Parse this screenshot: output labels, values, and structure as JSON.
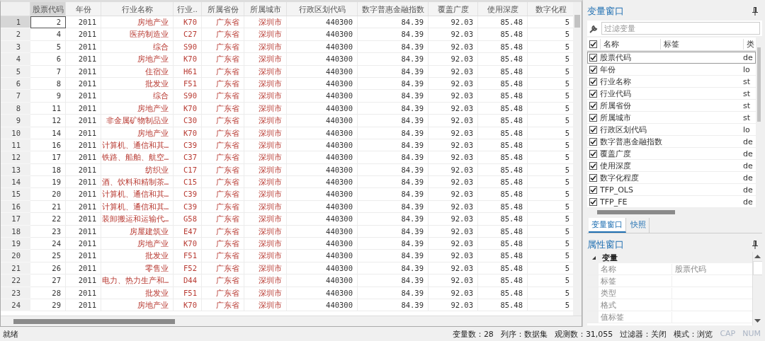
{
  "data_editor": {
    "columns": [
      {
        "label": "股票代码",
        "kind": "numeric",
        "selected": true
      },
      {
        "label": "年份",
        "kind": "numeric",
        "selected": false
      },
      {
        "label": "行业名称",
        "kind": "string",
        "selected": false
      },
      {
        "label": "行业..",
        "kind": "string",
        "selected": false
      },
      {
        "label": "所属省份",
        "kind": "string",
        "selected": false
      },
      {
        "label": "所属城市",
        "kind": "string",
        "selected": false
      },
      {
        "label": "行政区划代码",
        "kind": "numeric",
        "selected": false
      },
      {
        "label": "数字普惠金融指数",
        "kind": "numeric",
        "selected": false
      },
      {
        "label": "覆盖广度",
        "kind": "numeric",
        "selected": false
      },
      {
        "label": "使用深度",
        "kind": "numeric",
        "selected": false
      },
      {
        "label": "数字化程",
        "kind": "numeric",
        "selected": false
      }
    ],
    "rows": [
      {
        "label": "1",
        "selected": true,
        "cells": [
          "2",
          "2011",
          "房地产业",
          "K70",
          "广东省",
          "深圳市",
          "440300",
          "84.39",
          "92.03",
          "85.48",
          "5"
        ]
      },
      {
        "label": "2",
        "selected": false,
        "cells": [
          "4",
          "2011",
          "医药制造业",
          "C27",
          "广东省",
          "深圳市",
          "440300",
          "84.39",
          "92.03",
          "85.48",
          "5"
        ]
      },
      {
        "label": "3",
        "selected": false,
        "cells": [
          "5",
          "2011",
          "综合",
          "S90",
          "广东省",
          "深圳市",
          "440300",
          "84.39",
          "92.03",
          "85.48",
          "5"
        ]
      },
      {
        "label": "4",
        "selected": false,
        "cells": [
          "6",
          "2011",
          "房地产业",
          "K70",
          "广东省",
          "深圳市",
          "440300",
          "84.39",
          "92.03",
          "85.48",
          "5"
        ]
      },
      {
        "label": "5",
        "selected": false,
        "cells": [
          "7",
          "2011",
          "住宿业",
          "H61",
          "广东省",
          "深圳市",
          "440300",
          "84.39",
          "92.03",
          "85.48",
          "5"
        ]
      },
      {
        "label": "6",
        "selected": false,
        "cells": [
          "8",
          "2011",
          "批发业",
          "F51",
          "广东省",
          "深圳市",
          "440300",
          "84.39",
          "92.03",
          "85.48",
          "5"
        ]
      },
      {
        "label": "7",
        "selected": false,
        "cells": [
          "9",
          "2011",
          "综合",
          "S90",
          "广东省",
          "深圳市",
          "440300",
          "84.39",
          "92.03",
          "85.48",
          "5"
        ]
      },
      {
        "label": "8",
        "selected": false,
        "cells": [
          "11",
          "2011",
          "房地产业",
          "K70",
          "广东省",
          "深圳市",
          "440300",
          "84.39",
          "92.03",
          "85.48",
          "5"
        ]
      },
      {
        "label": "9",
        "selected": false,
        "cells": [
          "12",
          "2011",
          "非金属矿物制品业",
          "C30",
          "广东省",
          "深圳市",
          "440300",
          "84.39",
          "92.03",
          "85.48",
          "5"
        ]
      },
      {
        "label": "10",
        "selected": false,
        "cells": [
          "14",
          "2011",
          "房地产业",
          "K70",
          "广东省",
          "深圳市",
          "440300",
          "84.39",
          "92.03",
          "85.48",
          "5"
        ]
      },
      {
        "label": "11",
        "selected": false,
        "cells": [
          "16",
          "2011",
          "计算机、通信和其…",
          "C39",
          "广东省",
          "深圳市",
          "440300",
          "84.39",
          "92.03",
          "85.48",
          "5"
        ]
      },
      {
        "label": "12",
        "selected": false,
        "cells": [
          "17",
          "2011",
          "铁路、船舶、航空…",
          "C37",
          "广东省",
          "深圳市",
          "440300",
          "84.39",
          "92.03",
          "85.48",
          "5"
        ]
      },
      {
        "label": "13",
        "selected": false,
        "cells": [
          "18",
          "2011",
          "纺织业",
          "C17",
          "广东省",
          "深圳市",
          "440300",
          "84.39",
          "92.03",
          "85.48",
          "5"
        ]
      },
      {
        "label": "14",
        "selected": false,
        "cells": [
          "19",
          "2011",
          "酒、饮料和精制茶…",
          "C15",
          "广东省",
          "深圳市",
          "440300",
          "84.39",
          "92.03",
          "85.48",
          "5"
        ]
      },
      {
        "label": "15",
        "selected": false,
        "cells": [
          "20",
          "2011",
          "计算机、通信和其…",
          "C39",
          "广东省",
          "深圳市",
          "440300",
          "84.39",
          "92.03",
          "85.48",
          "5"
        ]
      },
      {
        "label": "16",
        "selected": false,
        "cells": [
          "21",
          "2011",
          "计算机、通信和其…",
          "C39",
          "广东省",
          "深圳市",
          "440300",
          "84.39",
          "92.03",
          "85.48",
          "5"
        ]
      },
      {
        "label": "17",
        "selected": false,
        "cells": [
          "22",
          "2011",
          "装卸搬运和运输代…",
          "G58",
          "广东省",
          "深圳市",
          "440300",
          "84.39",
          "92.03",
          "85.48",
          "5"
        ]
      },
      {
        "label": "18",
        "selected": false,
        "cells": [
          "23",
          "2011",
          "房屋建筑业",
          "E47",
          "广东省",
          "深圳市",
          "440300",
          "84.39",
          "92.03",
          "85.48",
          "5"
        ]
      },
      {
        "label": "19",
        "selected": false,
        "cells": [
          "24",
          "2011",
          "房地产业",
          "K70",
          "广东省",
          "深圳市",
          "440300",
          "84.39",
          "92.03",
          "85.48",
          "5"
        ]
      },
      {
        "label": "20",
        "selected": false,
        "cells": [
          "25",
          "2011",
          "批发业",
          "F51",
          "广东省",
          "深圳市",
          "440300",
          "84.39",
          "92.03",
          "85.48",
          "5"
        ]
      },
      {
        "label": "21",
        "selected": false,
        "cells": [
          "26",
          "2011",
          "零售业",
          "F52",
          "广东省",
          "深圳市",
          "440300",
          "84.39",
          "92.03",
          "85.48",
          "5"
        ]
      },
      {
        "label": "22",
        "selected": false,
        "cells": [
          "27",
          "2011",
          "电力、热力生产和…",
          "D44",
          "广东省",
          "深圳市",
          "440300",
          "84.39",
          "92.03",
          "85.48",
          "5"
        ]
      },
      {
        "label": "23",
        "selected": false,
        "cells": [
          "28",
          "2011",
          "批发业",
          "F51",
          "广东省",
          "深圳市",
          "440300",
          "84.39",
          "92.03",
          "85.48",
          "5"
        ]
      },
      {
        "label": "24",
        "selected": false,
        "cells": [
          "29",
          "2011",
          "房地产业",
          "K70",
          "广东省",
          "深圳市",
          "440300",
          "84.39",
          "92.03",
          "85.48",
          "5"
        ]
      }
    ]
  },
  "variables_window": {
    "title": "变量窗口",
    "filter": {
      "placeholder": "过滤变量"
    },
    "header_checked": true,
    "columns": [
      "名称",
      "标签",
      "类"
    ],
    "variables": [
      {
        "name": "股票代码",
        "type": "de",
        "checked": true,
        "selected": true
      },
      {
        "name": "年份",
        "type": "lo",
        "checked": true,
        "selected": false
      },
      {
        "name": "行业名称",
        "type": "st",
        "checked": true,
        "selected": false
      },
      {
        "name": "行业代码",
        "type": "st",
        "checked": true,
        "selected": false
      },
      {
        "name": "所属省份",
        "type": "st",
        "checked": true,
        "selected": false
      },
      {
        "name": "所属城市",
        "type": "st",
        "checked": true,
        "selected": false
      },
      {
        "name": "行政区划代码",
        "type": "lo",
        "checked": true,
        "selected": false
      },
      {
        "name": "数字普惠金融指数",
        "type": "de",
        "checked": true,
        "selected": false
      },
      {
        "name": "覆盖广度",
        "type": "de",
        "checked": true,
        "selected": false
      },
      {
        "name": "使用深度",
        "type": "de",
        "checked": true,
        "selected": false
      },
      {
        "name": "数字化程度",
        "type": "de",
        "checked": true,
        "selected": false
      },
      {
        "name": "TFP_OLS",
        "type": "de",
        "checked": true,
        "selected": false
      },
      {
        "name": "TFP_FE",
        "type": "de",
        "checked": true,
        "selected": false
      }
    ]
  },
  "panel_tabs": [
    {
      "label": "变量窗口",
      "selected": true
    },
    {
      "label": "快照",
      "selected": false
    }
  ],
  "properties_window": {
    "title": "属性窗口",
    "groups": [
      {
        "label": "变量",
        "expanded": true,
        "rows": [
          {
            "name": "名称",
            "value": "股票代码"
          },
          {
            "name": "标签"
          },
          {
            "name": "类型"
          },
          {
            "name": "格式"
          },
          {
            "name": "值标签"
          }
        ]
      }
    ]
  },
  "status_bar": {
    "text": "就绪",
    "items": [
      "变量数：28",
      "列序：数据集",
      "观测数：31,055",
      "过滤器：关闭",
      "模式：浏览"
    ],
    "indicators": [
      {
        "label": "CAP",
        "on": false
      },
      {
        "label": "NUM",
        "on": false
      }
    ]
  }
}
